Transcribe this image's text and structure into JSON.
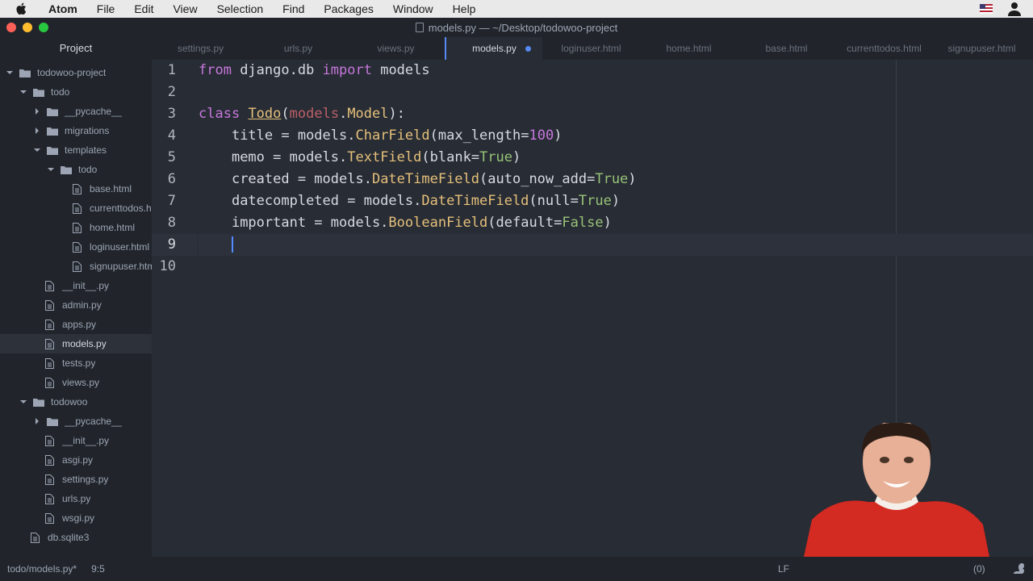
{
  "menubar": {
    "app_name": "Atom",
    "items": [
      "File",
      "Edit",
      "View",
      "Selection",
      "Find",
      "Packages",
      "Window",
      "Help"
    ]
  },
  "window": {
    "title": "models.py — ~/Desktop/todowoo-project"
  },
  "tabs": {
    "project_label": "Project",
    "files": [
      {
        "label": "settings.py"
      },
      {
        "label": "urls.py"
      },
      {
        "label": "views.py"
      },
      {
        "label": "models.py",
        "active": true,
        "modified": true
      },
      {
        "label": "loginuser.html"
      },
      {
        "label": "home.html"
      },
      {
        "label": "base.html"
      },
      {
        "label": "currenttodos.html"
      },
      {
        "label": "signupuser.html"
      }
    ]
  },
  "tree": [
    {
      "label": "todowoo-project",
      "type": "folder",
      "open": true
    },
    {
      "label": "todo",
      "type": "folder",
      "open": true
    },
    {
      "label": "__pycache__",
      "type": "folder",
      "open": false
    },
    {
      "label": "migrations",
      "type": "folder",
      "open": false
    },
    {
      "label": "templates",
      "type": "folder",
      "open": true
    },
    {
      "label": "todo",
      "type": "folder",
      "open": true
    },
    {
      "label": "base.html",
      "type": "file"
    },
    {
      "label": "currenttodos.html",
      "type": "file"
    },
    {
      "label": "home.html",
      "type": "file"
    },
    {
      "label": "loginuser.html",
      "type": "file"
    },
    {
      "label": "signupuser.html",
      "type": "file"
    },
    {
      "label": "__init__.py",
      "type": "file"
    },
    {
      "label": "admin.py",
      "type": "file"
    },
    {
      "label": "apps.py",
      "type": "file"
    },
    {
      "label": "models.py",
      "type": "file",
      "selected": true
    },
    {
      "label": "tests.py",
      "type": "file"
    },
    {
      "label": "views.py",
      "type": "file"
    },
    {
      "label": "todowoo",
      "type": "folder",
      "open": true
    },
    {
      "label": "__pycache__",
      "type": "folder",
      "open": false
    },
    {
      "label": "__init__.py",
      "type": "file"
    },
    {
      "label": "asgi.py",
      "type": "file"
    },
    {
      "label": "settings.py",
      "type": "file"
    },
    {
      "label": "urls.py",
      "type": "file"
    },
    {
      "label": "wsgi.py",
      "type": "file"
    },
    {
      "label": "db.sqlite3",
      "type": "file"
    }
  ],
  "editor": {
    "line_numbers": [
      "1",
      "2",
      "3",
      "4",
      "5",
      "6",
      "7",
      "8",
      "9",
      "10"
    ],
    "current_line": "9",
    "code": {
      "line1": {
        "from": "from",
        "module": " django.db ",
        "import": "import",
        "name": " models"
      },
      "line3": {
        "class": "class",
        "space": " ",
        "name": "Todo",
        "open": "(",
        "base_mod": "models",
        "dot": ".",
        "base_cls": "Model",
        "close": "):"
      },
      "line4": {
        "indent": "    ",
        "field": "title = models.",
        "type": "CharField",
        "open": "(",
        "param": "max_length",
        "eq": "=",
        "value": "100",
        "close": ")"
      },
      "line5": {
        "indent": "    ",
        "field": "memo = models.",
        "type": "TextField",
        "open": "(",
        "param": "blank",
        "eq": "=",
        "value": "True",
        "close": ")"
      },
      "line6": {
        "indent": "    ",
        "field": "created = models.",
        "type": "DateTimeField",
        "open": "(",
        "param": "auto_now_add",
        "eq": "=",
        "value": "True",
        "close": ")"
      },
      "line7": {
        "indent": "    ",
        "field": "datecompleted = models.",
        "type": "DateTimeField",
        "open": "(",
        "param": "null",
        "eq": "=",
        "value": "True",
        "close": ")"
      },
      "line8": {
        "indent": "    ",
        "field": "important = models.",
        "type": "BooleanField",
        "open": "(",
        "param": "default",
        "eq": "=",
        "value": "False",
        "close": ")"
      },
      "line9": {
        "indent": "    "
      }
    }
  },
  "statusbar": {
    "path": "todo/models.py*",
    "position": "9:5",
    "line_ending": "LF",
    "right_fragment": "(0)"
  },
  "colors": {
    "accent": "#568af2",
    "keyword": "#c678dd",
    "class_name": "#e5c07b",
    "number": "#d19a66",
    "constant": "#56b6c2"
  }
}
